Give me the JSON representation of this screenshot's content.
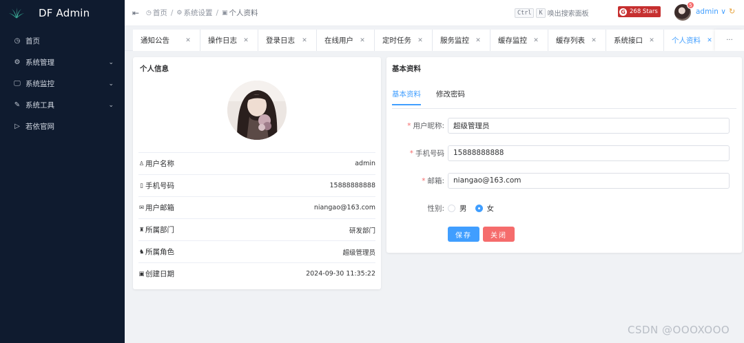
{
  "app": {
    "title": "DF Admin"
  },
  "sidebar": {
    "items": [
      {
        "label": "首页",
        "icon": "dashboard-icon",
        "glyph": "◷",
        "expandable": false
      },
      {
        "label": "系统管理",
        "icon": "gear-icon",
        "glyph": "⚙",
        "expandable": true
      },
      {
        "label": "系统监控",
        "icon": "monitor-icon",
        "glyph": "🖵",
        "expandable": true
      },
      {
        "label": "系统工具",
        "icon": "tool-icon",
        "glyph": "✎",
        "expandable": true
      },
      {
        "label": "若依官网",
        "icon": "send-icon",
        "glyph": "▷",
        "expandable": false
      }
    ]
  },
  "header": {
    "breadcrumb": [
      "首页",
      "系统设置",
      "个人资料"
    ],
    "search_hint": "唤出搜索面板",
    "search_keys": [
      "Ctrl",
      "K"
    ],
    "stars": "268 Stars",
    "notification_count": "5",
    "user_name": "admin"
  },
  "tabs": [
    {
      "label": "通知公告",
      "active": false
    },
    {
      "label": "操作日志",
      "active": false
    },
    {
      "label": "登录日志",
      "active": false
    },
    {
      "label": "在线用户",
      "active": false
    },
    {
      "label": "定时任务",
      "active": false
    },
    {
      "label": "服务监控",
      "active": false
    },
    {
      "label": "缓存监控",
      "active": false
    },
    {
      "label": "缓存列表",
      "active": false
    },
    {
      "label": "系统接口",
      "active": false
    },
    {
      "label": "个人资料",
      "active": true
    }
  ],
  "tabs_more": "···",
  "profile_card": {
    "title": "个人信息",
    "rows": [
      {
        "label": "用户名称",
        "value": "admin",
        "icon": "user-icon",
        "glyph": "♙"
      },
      {
        "label": "手机号码",
        "value": "15888888888",
        "icon": "phone-icon",
        "glyph": "▯"
      },
      {
        "label": "用户邮箱",
        "value": "niangao@163.com",
        "icon": "mail-icon",
        "glyph": "✉"
      },
      {
        "label": "所属部门",
        "value": "研发部门",
        "icon": "tree-icon",
        "glyph": "♜"
      },
      {
        "label": "所属角色",
        "value": "超级管理员",
        "icon": "people-icon",
        "glyph": "♞"
      },
      {
        "label": "创建日期",
        "value": "2024-09-30 11:35:22",
        "icon": "date-icon",
        "glyph": "▣"
      }
    ]
  },
  "basic_card": {
    "title": "基本资料",
    "tabs": [
      "基本资料",
      "修改密码"
    ],
    "fields": {
      "nickname": {
        "label": "用户昵称:",
        "value": "超级管理员"
      },
      "phone": {
        "label": "手机号码",
        "value": "15888888888"
      },
      "email": {
        "label": "邮箱:",
        "value": "niangao@163.com"
      },
      "gender": {
        "label": "性别:",
        "options": [
          "男",
          "女"
        ],
        "selected": "女"
      }
    },
    "save_label": "保存",
    "close_label": "关闭"
  },
  "watermark": "CSDN @OOOXOOO"
}
